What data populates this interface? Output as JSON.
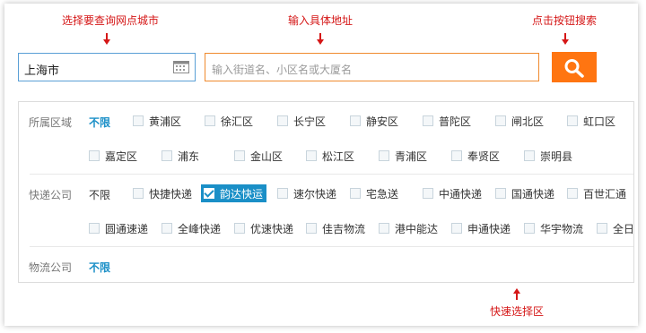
{
  "annotations": {
    "select_city": "选择要查询网点城市",
    "enter_address": "输入具体地址",
    "search_btn": "点击按钮搜索",
    "quick_select": "快速选择区"
  },
  "search": {
    "city_value": "上海市",
    "address_placeholder": "输入街道名、小区名或大厦名",
    "calendar_icon": "calendar-icon",
    "search_icon": "magnifier-icon"
  },
  "filters": {
    "district": {
      "label": "所属区域",
      "all_label": "不限",
      "all_selected": true,
      "options": [
        "黄浦区",
        "徐汇区",
        "长宁区",
        "静安区",
        "普陀区",
        "闸北区",
        "虹口区",
        "嘉定区",
        "浦东",
        "金山区",
        "松江区",
        "青浦区",
        "奉贤区",
        "崇明县"
      ]
    },
    "courier": {
      "label": "快递公司",
      "all_label": "不限",
      "all_selected": false,
      "options": [
        "快捷快递",
        "韵达快运",
        "速尔快递",
        "宅急送",
        "中通快递",
        "国通快递",
        "百世汇通",
        "圆通速递",
        "全峰快递",
        "优速快递",
        "佳吉物流",
        "港中能达",
        "申通快递",
        "华宇物流",
        "全日"
      ],
      "checked": "韵达快运"
    },
    "logistics": {
      "label": "物流公司",
      "all_label": "不限",
      "all_selected": true
    }
  },
  "colors": {
    "accent_orange": "#ff7511",
    "accent_blue": "#1a8fc7",
    "annotation_red": "#d51717"
  }
}
